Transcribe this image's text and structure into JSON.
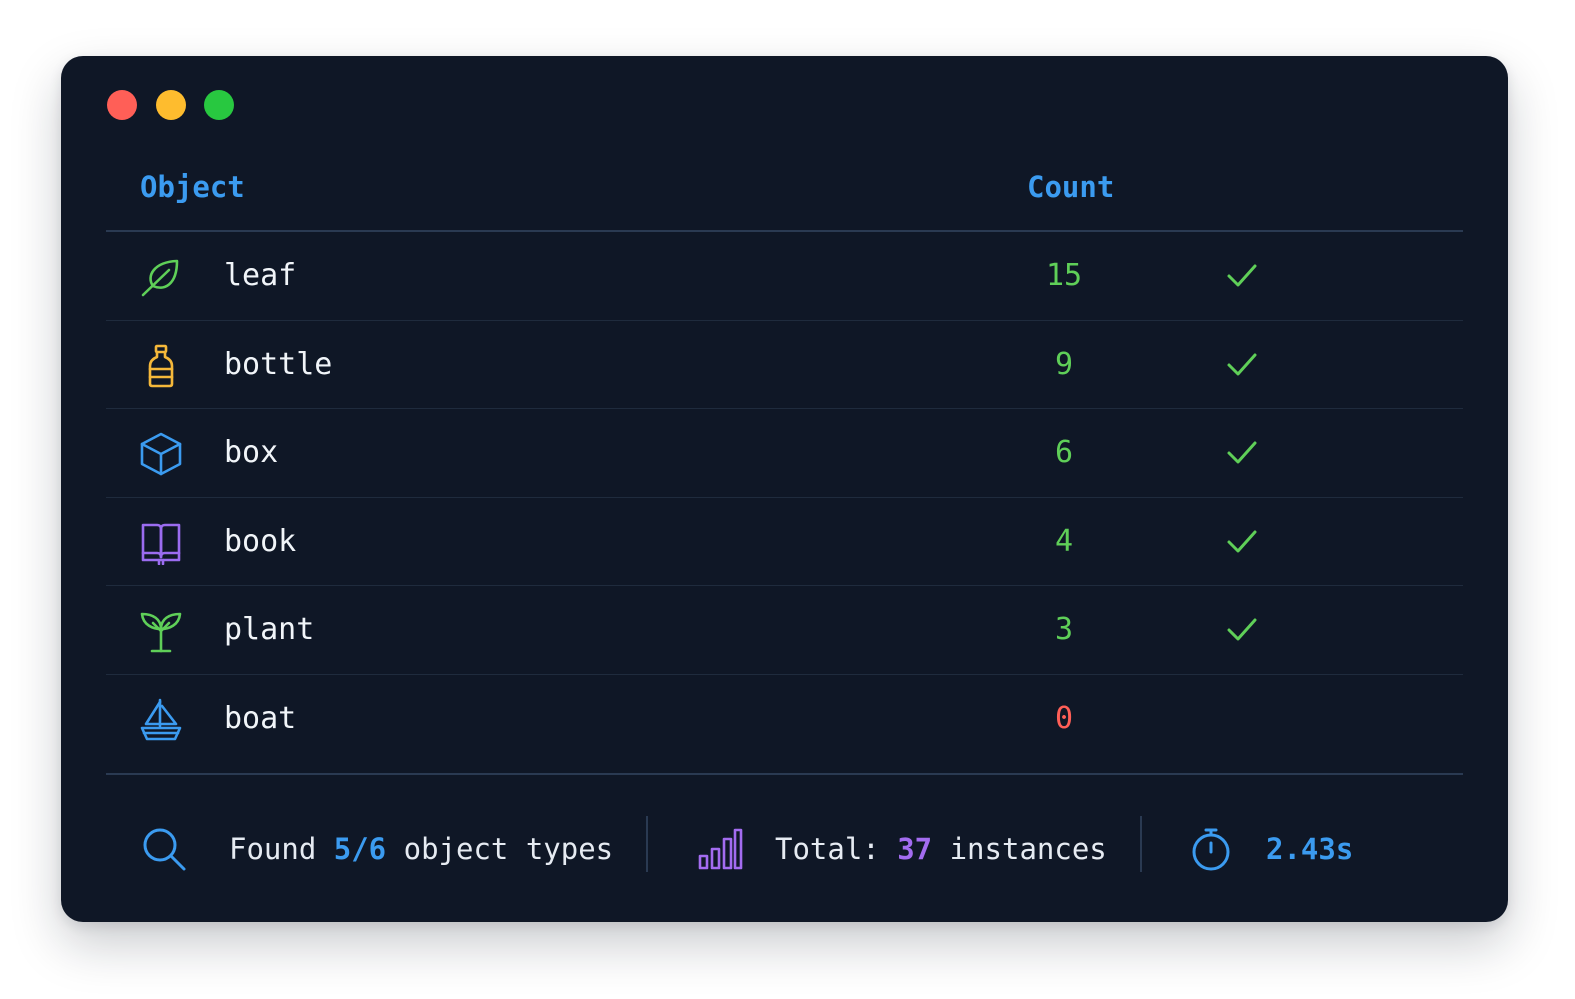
{
  "colors": {
    "window_bg": "#0f1726",
    "header": "#3b9bf0",
    "count_found": "#5fcf58",
    "count_missing": "#ff5f57",
    "check": "#5fcf58",
    "accent_blue": "#3b9bf0",
    "accent_purple": "#a36cf0"
  },
  "table": {
    "header_object": "Object",
    "header_count": "Count",
    "rows": [
      {
        "icon": "leaf-icon",
        "icon_color": "#5fcf58",
        "name": "leaf",
        "count": "15",
        "found": true
      },
      {
        "icon": "bottle-icon",
        "icon_color": "#f5b83a",
        "name": "bottle",
        "count": "9",
        "found": true
      },
      {
        "icon": "box-icon",
        "icon_color": "#3b9bf0",
        "name": "box",
        "count": "6",
        "found": true
      },
      {
        "icon": "book-icon",
        "icon_color": "#9b6cf0",
        "name": "book",
        "count": "4",
        "found": true
      },
      {
        "icon": "plant-icon",
        "icon_color": "#5fcf58",
        "name": "plant",
        "count": "3",
        "found": true
      },
      {
        "icon": "boat-icon",
        "icon_color": "#3b9bf0",
        "name": "boat",
        "count": "0",
        "found": false
      }
    ]
  },
  "footer": {
    "found_prefix": "Found ",
    "found_value": "5/6",
    "found_suffix": " object types",
    "total_prefix": "Total: ",
    "total_value": "37",
    "total_suffix": " instances",
    "time_value": "2.43s"
  }
}
